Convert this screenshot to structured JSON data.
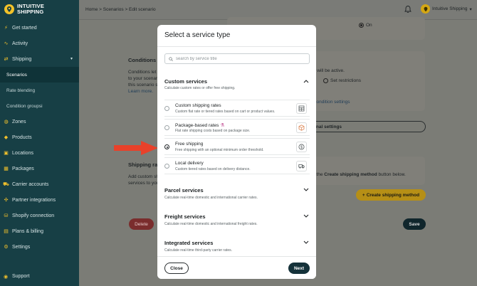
{
  "brand": {
    "line1": "INTUITIVE",
    "line2": "SHIPPING"
  },
  "colors": {
    "sidebar": "#173f45",
    "accent": "#f2c229",
    "primary_button": "#15323a",
    "arrow": "#e8412a"
  },
  "sidebar": {
    "items": [
      {
        "label": "Get started",
        "icon": "bolt-icon"
      },
      {
        "label": "Activity",
        "icon": "activity-icon"
      },
      {
        "label": "Shipping",
        "icon": "shipping-icon"
      },
      {
        "label": "Zones",
        "icon": "zones-icon"
      },
      {
        "label": "Products",
        "icon": "products-icon"
      },
      {
        "label": "Locations",
        "icon": "location-icon"
      },
      {
        "label": "Packages",
        "icon": "packages-icon"
      },
      {
        "label": "Carrier accounts",
        "icon": "truck-icon"
      },
      {
        "label": "Partner integrations",
        "icon": "integrations-icon"
      },
      {
        "label": "Shopify connection",
        "icon": "shopify-icon"
      },
      {
        "label": "Plans & billing",
        "icon": "billing-icon"
      },
      {
        "label": "Settings",
        "icon": "gear-icon"
      }
    ],
    "sub_items": [
      "Scenarios",
      "Rate blending",
      "Condition groups"
    ],
    "support": "Support"
  },
  "topbar": {
    "breadcrumb": "Home > Scenarios > Edit scenario",
    "account": "Intuitive Shipping"
  },
  "background": {
    "on_label": "On",
    "conditions_title": "Conditions",
    "conditions_text": [
      "Conditions let you",
      "to your scenario",
      "this scenario sh"
    ],
    "learn_more": "Learn more.",
    "will_be_active": "nario will be active.",
    "set_restrictions": "Set restrictions",
    "condition_settings": "ced condition settings",
    "optional_settings": "ptional settings",
    "shipping_rates_title": "Shipping rat",
    "shipping_rates_text": [
      "Add custom sh",
      "services to you"
    ],
    "create_hint_pre": "g the ",
    "create_hint_bold": "Create shipping method",
    "create_hint_post": " button below.",
    "create_button": "Create shipping method",
    "delete_button": "Delete",
    "save_button": "Save"
  },
  "modal": {
    "title": "Select a service type",
    "search_placeholder": "search by service title",
    "custom": {
      "title": "Custom services",
      "subtitle": "Calculate custom rates or offer free shipping.",
      "options": [
        {
          "title": "Custom shipping rates",
          "desc": "Custom flat rate or tiered rates based on cart or product values.",
          "icon": "table-icon",
          "selected": false
        },
        {
          "title": "Package-based rates",
          "desc": "Flat rate shipping costs based on package size.",
          "icon": "package-icon",
          "selected": false
        },
        {
          "title": "Free shipping",
          "desc": "Free shipping with an optional minimum order threshold.",
          "icon": "free-shipping-icon",
          "selected": true
        },
        {
          "title": "Local delivery",
          "desc": "Custom tiered rates based on delivery distance.",
          "icon": "delivery-truck-icon",
          "selected": false
        }
      ]
    },
    "parcel": {
      "title": "Parcel services",
      "subtitle": "Calculate real-time domestic and international carrier rates."
    },
    "freight": {
      "title": "Freight services",
      "subtitle": "Calculate real-time domestic and international freight rates."
    },
    "integrated": {
      "title": "Integrated services",
      "subtitle": "Calculate real-time third-party carrier rates."
    },
    "close": "Close",
    "next": "Next"
  }
}
